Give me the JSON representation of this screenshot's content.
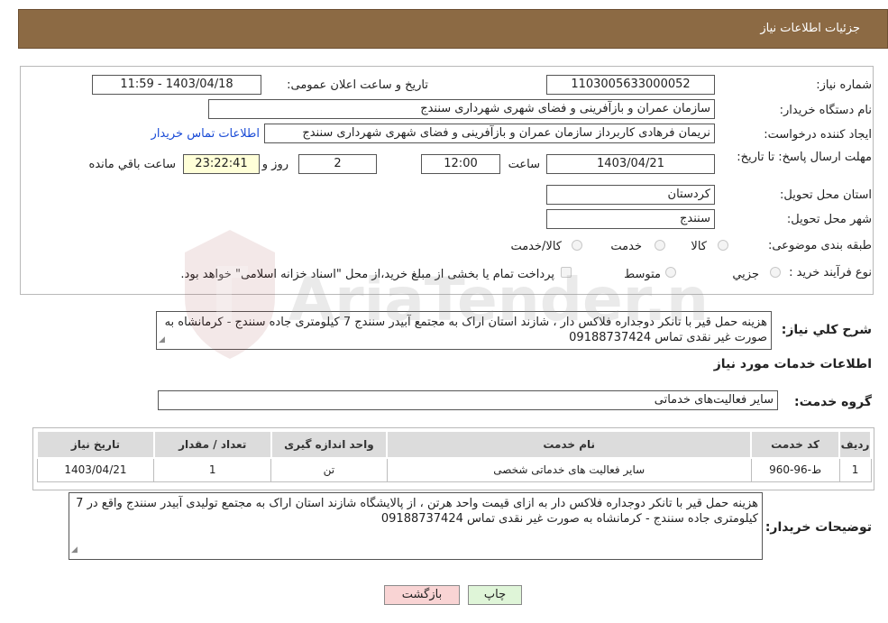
{
  "header": {
    "title": "جزئیات اطلاعات نیاز"
  },
  "labels": {
    "need_number": "شماره نیاز:",
    "announce_datetime": "تاریخ و ساعت اعلان عمومی:",
    "buyer_org": "نام دستگاه خریدار:",
    "requester": "ایجاد کننده درخواست:",
    "deadline": "مهلت ارسال پاسخ: تا تاریخ:",
    "time": "ساعت",
    "days_and": "روز و",
    "remaining": "ساعت باقي مانده",
    "province": "استان محل تحویل:",
    "city": "شهر محل تحویل:",
    "category": "طبقه بندی موضوعی:",
    "purchase_type": "نوع فرآیند خرید :",
    "summary": "شرح کلي نياز:",
    "services_info": "اطلاعات خدمات مورد نياز",
    "service_group": "گروه خدمت:",
    "buyer_notes": "توضیحات خریدار:"
  },
  "fields": {
    "need_number": "1103005633000052",
    "announce_datetime": "1403/04/18 - 11:59",
    "buyer_org": "سازمان عمران و بازآفرینی و فضای شهری شهرداری سنندج",
    "requester": "نریمان فرهادی کاربرداز سازمان عمران و بازآفرینی و فضای شهری شهرداری سنندج",
    "contact_link": "اطلاعات تماس خریدار",
    "deadline_date": "1403/04/21",
    "deadline_time": "12:00",
    "days": "2",
    "remaining_time": "23:22:41",
    "province": "کردستان",
    "city": "سنندج",
    "service_group": "سایر فعالیت‌های خدماتی"
  },
  "category_options": [
    "کالا",
    "خدمت",
    "کالا/خدمت"
  ],
  "purchase_options": [
    "جزیي",
    "متوسط"
  ],
  "purchase_note": "پرداخت تمام یا بخشی از مبلغ خرید،از محل \"اسناد خزانه اسلامی\" خواهد بود.",
  "summary_text": "هزینه حمل قیر با تانکر دوجداره فلاکس دار ، شازند استان اراک به مجتمع  آبیدر سنندج 7 کیلومتری جاده سنندج - کرمانشاه به صورت غیر نقدی تماس 09188737424",
  "table": {
    "headers": [
      "ردیف",
      "کد خدمت",
      "نام خدمت",
      "واحد اندازه گیری",
      "تعداد / مقدار",
      "تاریخ نیاز"
    ],
    "rows": [
      [
        "1",
        "ط-96-960",
        "سایر فعالیت های خدماتی شخصی",
        "تن",
        "1",
        "1403/04/21"
      ]
    ]
  },
  "buyer_notes_text": "هزینه حمل قیر با تانکر دوجداره فلاکس دار به ازای قیمت واحد هرتن ، از پالایشگاه شازند استان اراک به مجتمع تولیدی آبیدر سنندج واقع در 7 کیلومتری جاده سنندج - کرمانشاه به صورت غیر نقدی تماس 09188737424",
  "buttons": {
    "print": "چاپ",
    "back": "بازگشت"
  },
  "watermark": "AriaTender.net",
  "colors": {
    "header": "#8c6a44",
    "link": "#1a4bd6",
    "yellow": "#ffffd8",
    "back_button": "#f9d4d4",
    "print_button": "#dff5d8"
  }
}
